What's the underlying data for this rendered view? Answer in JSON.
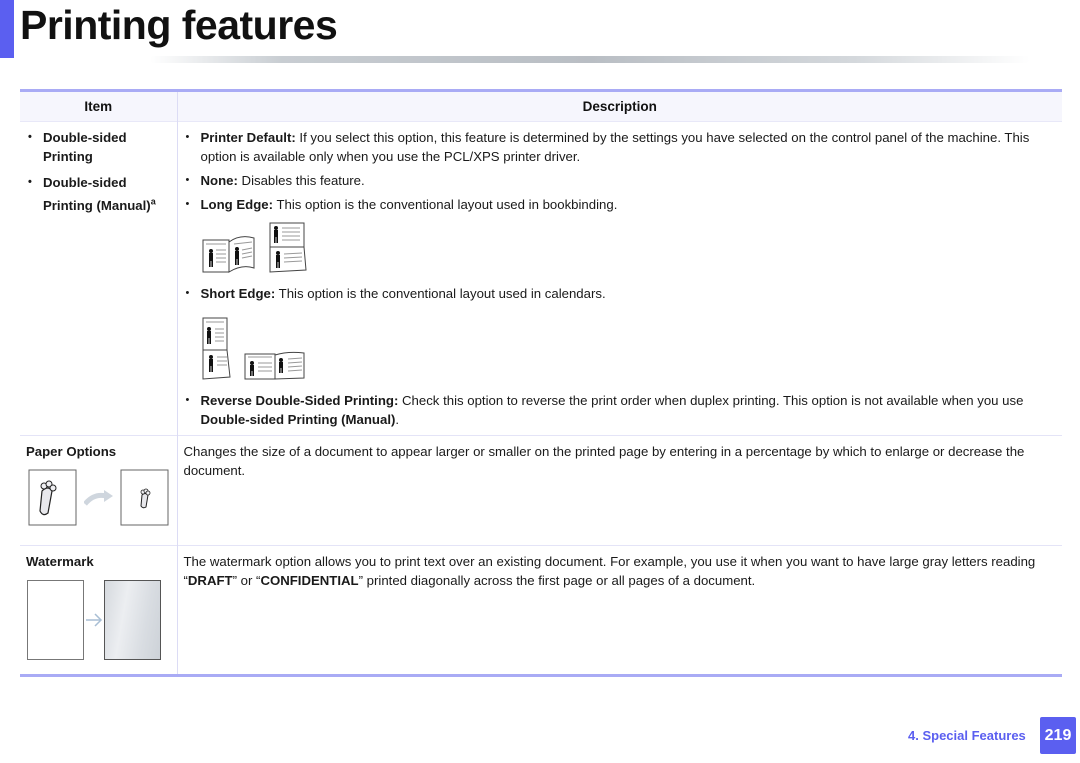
{
  "page": {
    "title": "Printing features",
    "accent_color": "#5b5ff0",
    "table_rule_color": "#a9abf5"
  },
  "table": {
    "headers": {
      "item": "Item",
      "description": "Description"
    },
    "rows": [
      {
        "items": [
          "Double-sided Printing",
          "Double-sided Printing (Manual)"
        ],
        "item_footnote": "a",
        "bullets": [
          {
            "label": "Printer Default:",
            "text": " If you select this option, this feature is determined by the settings you have selected on the control panel of the machine. This option is available only when you use the PCL/XPS printer driver."
          },
          {
            "label": "None:",
            "text": " Disables this feature."
          },
          {
            "label": "Long Edge:",
            "text": " This option is the conventional layout used in bookbinding.",
            "figure": "long-edge-binding-illustration"
          },
          {
            "label": "Short Edge:",
            "text": " This option is the conventional layout used in calendars.",
            "figure": "short-edge-binding-illustration"
          },
          {
            "label": "Reverse Double-Sided Printing:",
            "text": " Check this option to reverse the print order when duplex printing. This option is not available when you use ",
            "text_bold": "Double-sided Printing (Manual)",
            "text_end": "."
          }
        ]
      },
      {
        "item": "Paper Options",
        "figure": "resize-document-illustration",
        "description": "Changes the size of a document to appear larger or smaller on the printed page by entering in a percentage by which to enlarge or decrease the document."
      },
      {
        "item": "Watermark",
        "figure": "watermark-illustration",
        "description_parts": [
          "The watermark option allows you to print text over an existing document. For example, you use it when you want to have large gray letters reading “",
          "DRAFT",
          "” or “",
          "CONFIDENTIAL",
          "” printed diagonally across the first page or all pages of a document."
        ]
      }
    ]
  },
  "footer": {
    "chapter": "4.  Special Features",
    "page_number": "219"
  }
}
